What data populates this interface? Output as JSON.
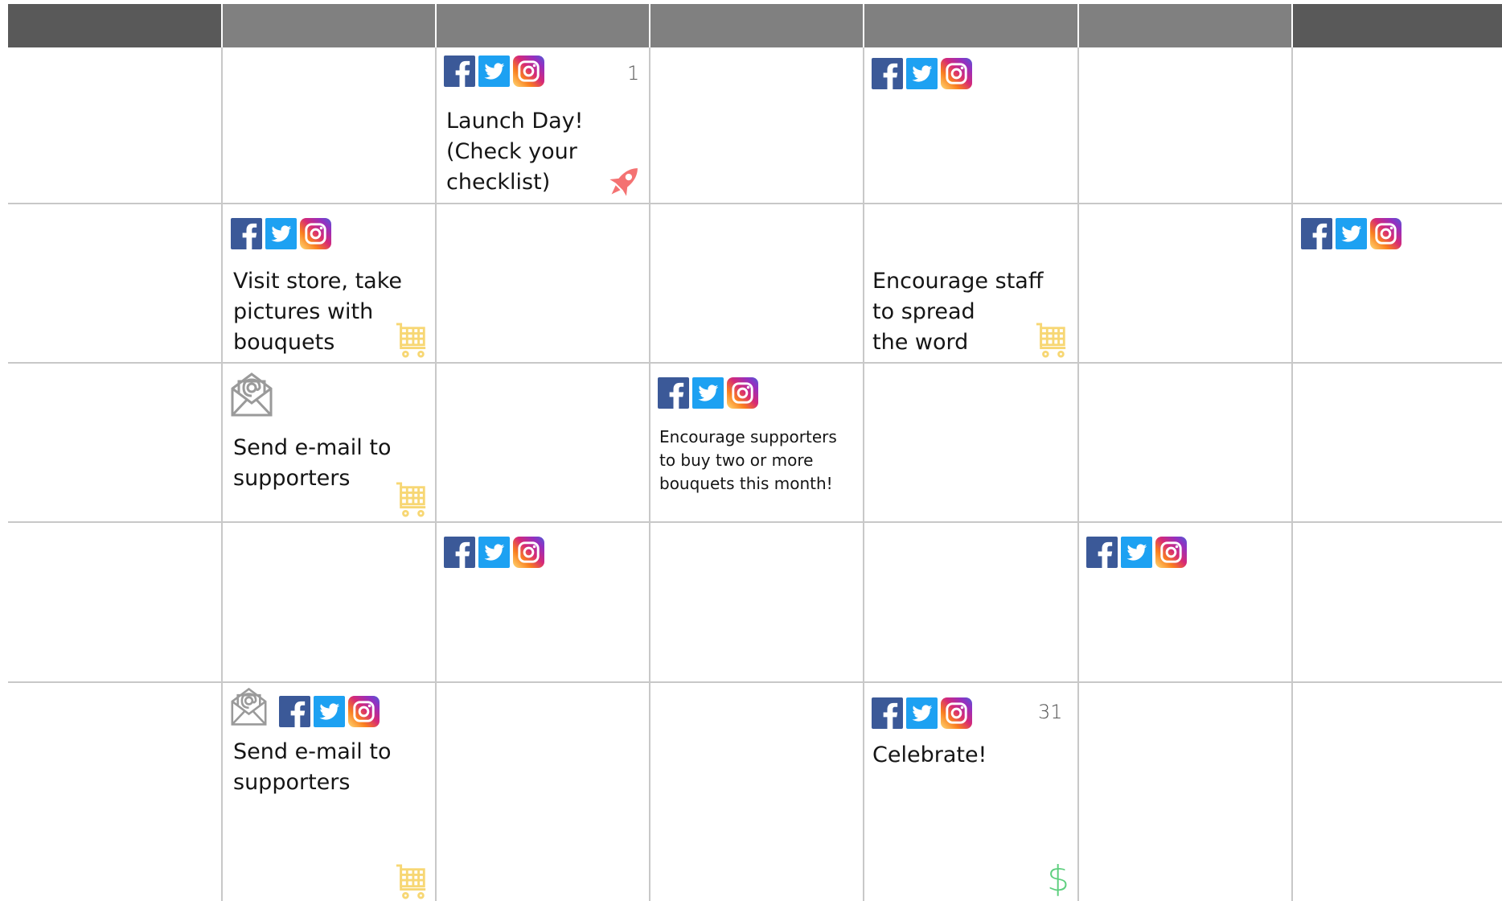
{
  "colors": {
    "header_gray": "#808080",
    "header_dark": "#595959",
    "grid_line": "#c8c8c8",
    "facebook": "#3b5998",
    "twitter": "#1da1f2",
    "instagram_gradient": [
      "#feda75",
      "#fa7e1e",
      "#d62976",
      "#962fbf",
      "#4f5bd5"
    ],
    "rocket": "#f47272",
    "cart": "#f7d774",
    "dollar": "#5fcf7f",
    "email": "#9a9a9a"
  },
  "header": {
    "columns": [
      "",
      "",
      "",
      "",
      "",
      "",
      ""
    ]
  },
  "icons": {
    "social": [
      "facebook-icon",
      "twitter-icon",
      "instagram-icon"
    ],
    "launch": "rocket-icon",
    "shop": "shopping-cart-icon",
    "email": "email-envelope-icon",
    "money": "dollar-sign-icon"
  },
  "cells": {
    "launch_day": {
      "day": "1",
      "text": "Launch Day!\n(Check your\nchecklist)"
    },
    "visit_store": {
      "text": "Visit store, take\npictures with\nbouquets"
    },
    "encourage_staff": {
      "text": "Encourage staff\nto spread\nthe word"
    },
    "send_email_1": {
      "text": "Send e-mail to\nsupporters"
    },
    "encourage_supporters": {
      "text": "Encourage supporters\nto buy two or more\nbouquets this month!"
    },
    "send_email_2": {
      "text": "Send e-mail to\nsupporters"
    },
    "celebrate": {
      "day": "31",
      "text": "Celebrate!"
    }
  }
}
